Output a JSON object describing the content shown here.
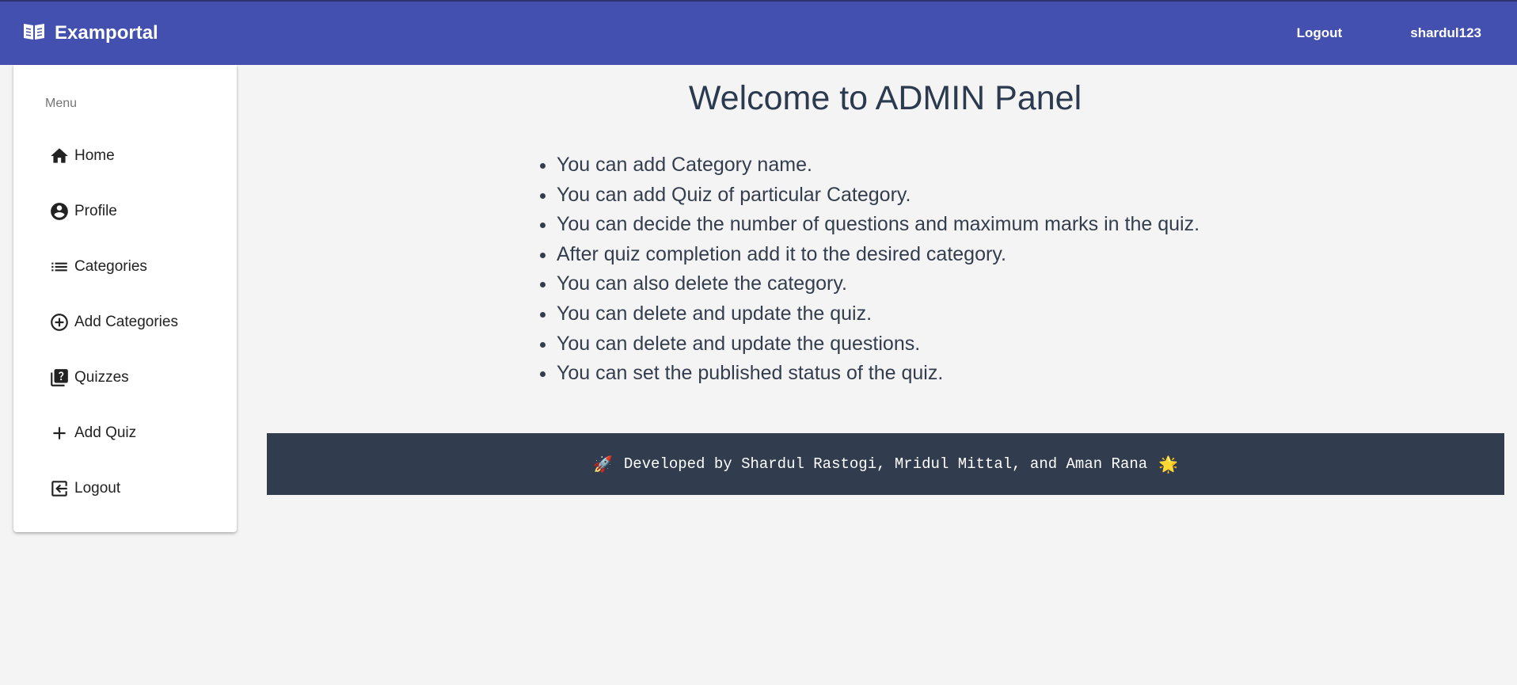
{
  "app": {
    "brand_name": "Examportal",
    "brand_icon": "book-icon",
    "accent_color": "#4350af"
  },
  "topbar": {
    "logout_label": "Logout",
    "username": "shardul123"
  },
  "sidebar": {
    "menu_title": "Menu",
    "items": [
      {
        "label": "Home",
        "icon": "home-icon"
      },
      {
        "label": "Profile",
        "icon": "account-circle-icon"
      },
      {
        "label": "Categories",
        "icon": "list-icon"
      },
      {
        "label": "Add Categories",
        "icon": "add-circle-icon"
      },
      {
        "label": "Quizzes",
        "icon": "quiz-icon"
      },
      {
        "label": "Add Quiz",
        "icon": "plus-icon"
      },
      {
        "label": "Logout",
        "icon": "logout-icon"
      }
    ]
  },
  "main": {
    "title": "Welcome to ADMIN Panel",
    "points": [
      "You can add Category name.",
      "You can add Quiz of particular Category.",
      "You can decide the number of questions and maximum marks in the quiz.",
      "After quiz completion add it to the desired category.",
      "You can also delete the category.",
      "You can delete and update the quiz.",
      "You can delete and update the questions.",
      "You can set the published status of the quiz."
    ]
  },
  "footer": {
    "left_emoji": "🚀",
    "text": "Developed by Shardul Rastogi, Mridul Mittal, and Aman Rana",
    "right_emoji": "🌟",
    "background_color": "#313c4f"
  }
}
